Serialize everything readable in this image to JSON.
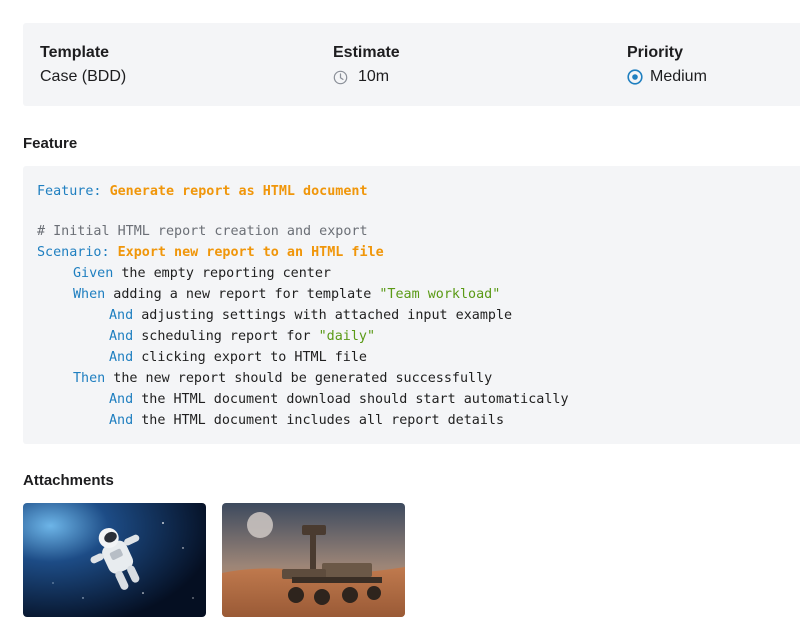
{
  "summary": {
    "template": {
      "title": "Template",
      "value": "Case (BDD)"
    },
    "estimate": {
      "title": "Estimate",
      "value": "10m",
      "icon": "clock-icon"
    },
    "priority": {
      "title": "Priority",
      "value": "Medium",
      "icon": "priority-target-icon",
      "color": "#1f7fc0"
    }
  },
  "feature_section": {
    "title": "Feature",
    "lines": [
      {
        "kw": "Feature: ",
        "title": "Generate report as HTML document"
      },
      {},
      {
        "comment": "# Initial HTML report creation and export"
      },
      {
        "kw": "Scenario: ",
        "title": "Export new report to an HTML file"
      },
      {
        "kw": "Given",
        "text": " the empty reporting center"
      },
      {
        "kw": "When",
        "text": " adding a new report for template ",
        "str": "\"Team workload\""
      },
      {
        "kw": "And",
        "text": " adjusting settings with attached input example"
      },
      {
        "kw": "And",
        "text": " scheduling report for ",
        "str": "\"daily\""
      },
      {
        "kw": "And",
        "text": " clicking export to HTML file"
      },
      {
        "kw": "Then",
        "text": " the new report should be generated successfully"
      },
      {
        "kw": "And",
        "text": " the HTML document download should start automatically"
      },
      {
        "kw": "And",
        "text": " the HTML document includes all report details"
      }
    ]
  },
  "attachments": {
    "title": "Attachments",
    "items": [
      {
        "name": "astronaut-image"
      },
      {
        "name": "mars-rover-image"
      }
    ]
  }
}
